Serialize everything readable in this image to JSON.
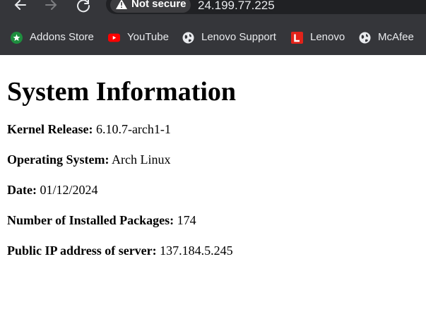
{
  "browser": {
    "security_label": "Not secure",
    "url": "24.199.77.225",
    "bookmarks": [
      {
        "label": "Addons Store",
        "icon": "addons-store-icon",
        "color": "#1e8e3e"
      },
      {
        "label": "YouTube",
        "icon": "youtube-icon",
        "color": "#ff0000"
      },
      {
        "label": "Lenovo Support",
        "icon": "globe-icon",
        "color": "#e8eaed"
      },
      {
        "label": "Lenovo",
        "icon": "lenovo-icon",
        "color": "#e2231a"
      },
      {
        "label": "McAfee",
        "icon": "globe-icon",
        "color": "#e8eaed"
      }
    ]
  },
  "page": {
    "title": "System Information",
    "items": [
      {
        "label": "Kernel Release:",
        "value": "6.10.7-arch1-1"
      },
      {
        "label": "Operating System:",
        "value": "Arch Linux"
      },
      {
        "label": "Date:",
        "value": "01/12/2024"
      },
      {
        "label": "Number of Installed Packages:",
        "value": "174"
      },
      {
        "label": "Public IP address of server:",
        "value": "137.184.5.245"
      }
    ]
  },
  "colors": {
    "chrome_bg": "#35363a",
    "omnibox_bg": "#202124",
    "chrome_text": "#e8eaed"
  }
}
